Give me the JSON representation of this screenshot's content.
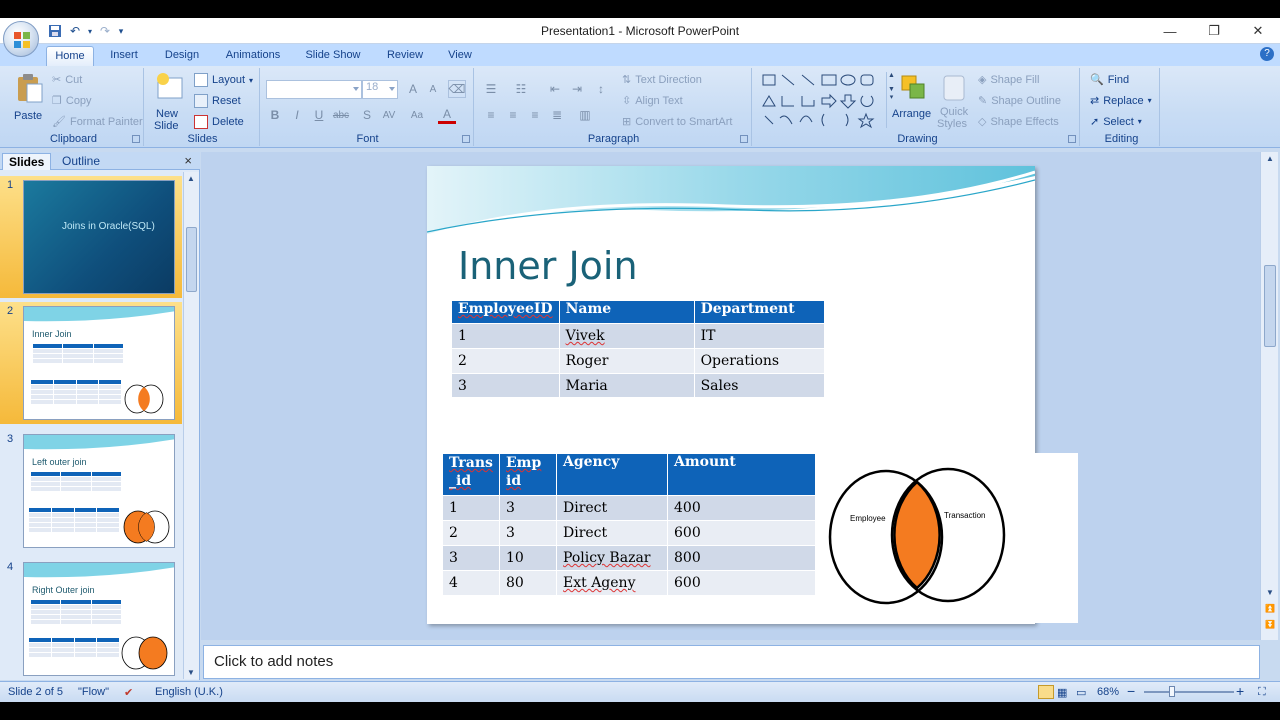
{
  "window": {
    "title": "Presentation1 - Microsoft PowerPoint",
    "minimize": "—",
    "restore": "❐",
    "close": "✕"
  },
  "ribbon_tabs": [
    "Home",
    "Insert",
    "Design",
    "Animations",
    "Slide Show",
    "Review",
    "View"
  ],
  "ribbon": {
    "clipboard": {
      "label": "Clipboard",
      "paste": "Paste",
      "cut": "Cut",
      "copy": "Copy",
      "format_painter": "Format Painter"
    },
    "slides": {
      "label": "Slides",
      "new_slide": "New",
      "new_slide2": "Slide",
      "layout": "Layout",
      "reset": "Reset",
      "delete": "Delete"
    },
    "font": {
      "label": "Font",
      "font_name": "",
      "font_size": "18",
      "bold": "B",
      "italic": "I",
      "underline": "U",
      "strike": "abc",
      "shadow": "S",
      "spacing": "AV",
      "case": "Aa",
      "color": "A"
    },
    "paragraph": {
      "label": "Paragraph",
      "text_direction": "Text Direction",
      "align_text": "Align Text",
      "smartart": "Convert to SmartArt"
    },
    "drawing": {
      "label": "Drawing",
      "arrange": "Arrange",
      "quick_styles": "Quick",
      "quick_styles2": "Styles",
      "shape_fill": "Shape Fill",
      "shape_outline": "Shape Outline",
      "shape_effects": "Shape Effects"
    },
    "editing": {
      "label": "Editing",
      "find": "Find",
      "replace": "Replace",
      "select": "Select"
    }
  },
  "pane": {
    "tab_slides": "Slides",
    "tab_outline": "Outline",
    "close": "×",
    "thumbnails": [
      {
        "num": "1",
        "title": "Joins in Oracle(SQL)"
      },
      {
        "num": "2",
        "title": "Inner Join"
      },
      {
        "num": "3",
        "title": "Left outer join"
      },
      {
        "num": "4",
        "title": "Right Outer join"
      }
    ]
  },
  "slide": {
    "title": "Inner Join",
    "table1": {
      "headers": [
        "EmployeeID",
        "Name",
        "Department"
      ],
      "rows": [
        [
          "1",
          "Vivek",
          "IT"
        ],
        [
          "2",
          "Roger",
          "Operations"
        ],
        [
          "3",
          "Maria",
          "Sales"
        ]
      ]
    },
    "table2": {
      "headers": [
        "Trans_id",
        "Emp_id",
        "Agency",
        "Amount"
      ],
      "header_lines": [
        [
          "Trans",
          "_id"
        ],
        [
          "Emp",
          "id"
        ]
      ],
      "rows": [
        [
          "1",
          "3",
          "Direct",
          "400"
        ],
        [
          "2",
          "3",
          "Direct",
          "600"
        ],
        [
          "3",
          "10",
          "Policy Bazar",
          "800"
        ],
        [
          "4",
          "80",
          "Ext Ageny",
          "600"
        ]
      ]
    },
    "venn": {
      "left_label": "Employee",
      "right_label": "Transaction",
      "overlap_color": "#f47b20"
    }
  },
  "notes_placeholder": "Click to add notes",
  "status": {
    "slide_info": "Slide 2 of 5",
    "theme": "\"Flow\"",
    "language": "English (U.K.)",
    "zoom": "68%",
    "zoom_out": "−",
    "zoom_in": "+"
  },
  "colors": {
    "accent": "#0e63b8",
    "ribbon": "#c8dcf4",
    "title_teal": "#1a6278"
  }
}
